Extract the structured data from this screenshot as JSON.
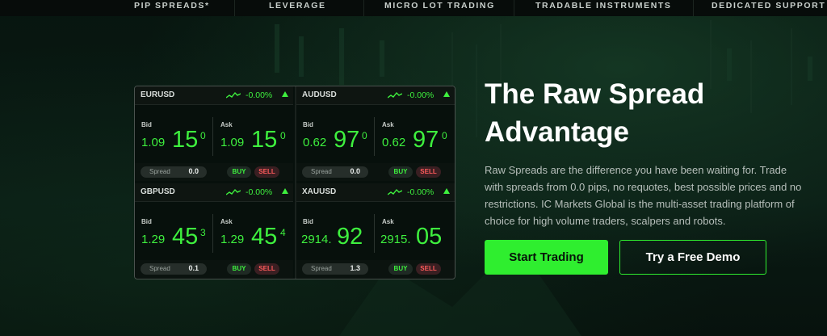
{
  "nav": {
    "items": [
      "PIP SPREADS*",
      "LEVERAGE",
      "MICRO LOT TRADING",
      "TRADABLE INSTRUMENTS",
      "DEDICATED SUPPORT"
    ]
  },
  "quotes": [
    {
      "symbol": "EURUSD",
      "change": "-0.00%",
      "bid_label": "Bid",
      "ask_label": "Ask",
      "bid_small": "1.09",
      "bid_big": "15",
      "bid_sup": "0",
      "ask_small": "1.09",
      "ask_big": "15",
      "ask_sup": "0",
      "spread_label": "Spread",
      "spread": "0.0",
      "buy": "BUY",
      "sell": "SELL"
    },
    {
      "symbol": "AUDUSD",
      "change": "-0.00%",
      "bid_label": "Bid",
      "ask_label": "Ask",
      "bid_small": "0.62",
      "bid_big": "97",
      "bid_sup": "0",
      "ask_small": "0.62",
      "ask_big": "97",
      "ask_sup": "0",
      "spread_label": "Spread",
      "spread": "0.0",
      "buy": "BUY",
      "sell": "SELL"
    },
    {
      "symbol": "GBPUSD",
      "change": "-0.00%",
      "bid_label": "Bid",
      "ask_label": "Ask",
      "bid_small": "1.29",
      "bid_big": "45",
      "bid_sup": "3",
      "ask_small": "1.29",
      "ask_big": "45",
      "ask_sup": "4",
      "spread_label": "Spread",
      "spread": "0.1",
      "buy": "BUY",
      "sell": "SELL"
    },
    {
      "symbol": "XAUUSD",
      "change": "-0.00%",
      "bid_label": "Bid",
      "ask_label": "Ask",
      "bid_small": "2914.",
      "bid_big": "92",
      "bid_sup": "",
      "ask_small": "2915.",
      "ask_big": "05",
      "ask_sup": "",
      "spread_label": "Spread",
      "spread": "1.3",
      "buy": "BUY",
      "sell": "SELL"
    }
  ],
  "hero": {
    "title_line1": "The Raw Spread",
    "title_line2": "Advantage",
    "description": "Raw Spreads are the difference you have been waiting for. Trade with spreads from 0.0 pips, no requotes, best possible prices and no restrictions. IC Markets Global is the multi-asset trading platform of choice for high volume traders, scalpers and robots.",
    "primary_cta": "Start Trading",
    "secondary_cta": "Try a Free Demo"
  },
  "colors": {
    "accent_green": "#2fee2f",
    "price_green": "#3ef03e",
    "sell_red": "#ff5b5b",
    "background": "#06120d"
  },
  "icons": {
    "sparkline": "trend-sparkline-icon",
    "change_arrow": "up-triangle-icon"
  }
}
